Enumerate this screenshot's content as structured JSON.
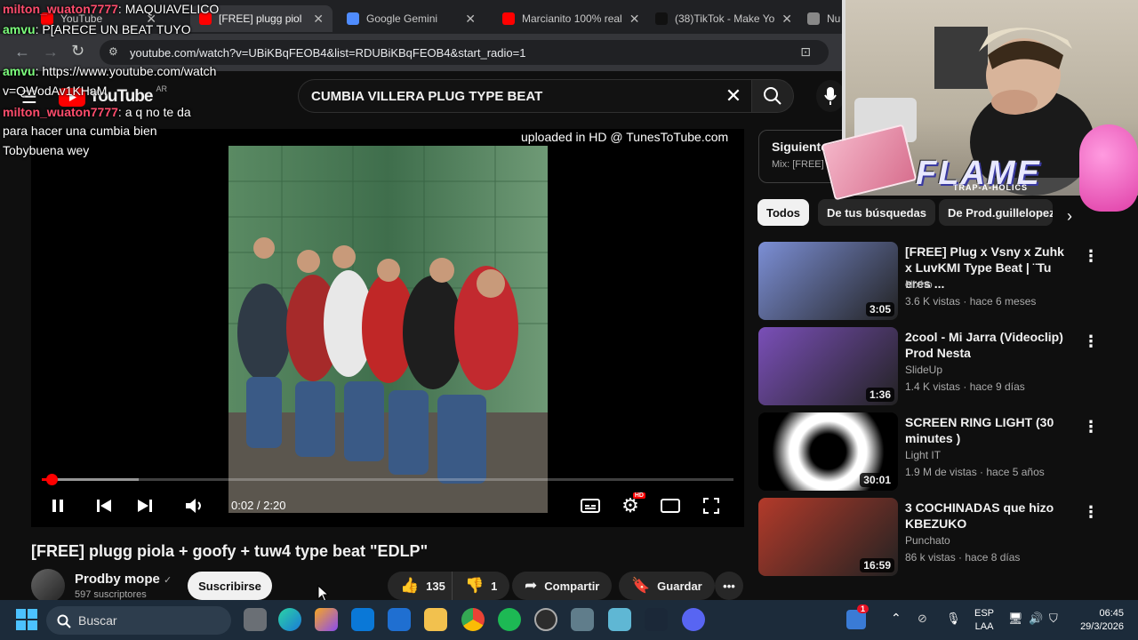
{
  "browser": {
    "tabs": [
      {
        "label": "YouTube",
        "favicon_color": "#ff0000"
      },
      {
        "label": "[FREE] plugg piol",
        "favicon_color": "#ff0000"
      },
      {
        "label": "Google Gemini",
        "favicon_color": "#4f8cff"
      },
      {
        "label": "Marcianito 100% real",
        "favicon_color": "#ff0000"
      },
      {
        "label": "(38)TikTok - Make Yo",
        "favicon_color": "#111111"
      },
      {
        "label": "Nu",
        "favicon_color": "#888888"
      }
    ],
    "url": "youtube.com/watch?v=UBiKBqFEOB4&list=RDUBiKBqFEOB4&start_radio=1"
  },
  "youtube": {
    "logo_text": "YouTube",
    "logo_region": "AR",
    "search_query": "CUMBIA VILLERA PLUG TYPE BEAT"
  },
  "player": {
    "watermark": "uploaded in HD @ TunesToTube.com",
    "time": "0:02 / 2:20",
    "progress_fraction": 0.014,
    "buffer_fraction": 0.14
  },
  "video": {
    "title": "[FREE] plugg piola + goofy + tuw4 type beat \"EDLP\"",
    "channel": "Prodby mope",
    "channel_verified_glyph": "✓",
    "subscribers": "597 suscriptores",
    "subscribe_label": "Suscribirse",
    "likes": "135",
    "dislikes": "1",
    "share_label": "Compartir",
    "save_label": "Guardar"
  },
  "chat": [
    {
      "user": "milton_wuaton7777",
      "msg": ": MAQUIAVELICO",
      "user_color": "#ff4d6d"
    },
    {
      "user": "amvu",
      "msg": ": P[ARECE UN BEAT TUYO",
      "user_color": "#7dff7d"
    },
    {
      "user": "amvu",
      "msg": ": https://www.youtube.com/watch",
      "user_color": "#7dff7d"
    },
    {
      "user": "",
      "msg": "v=QWodAv1KHaM",
      "user_color": "#ffffff"
    },
    {
      "user": "milton_wuaton7777",
      "msg": ": a q no te da",
      "user_color": "#ff4d6d"
    },
    {
      "user": "",
      "msg": "para hacer una cumbia bien",
      "user_color": "#ffffff"
    },
    {
      "user": "",
      "msg": "Tobybuena wey",
      "user_color": "#ffffff"
    }
  ],
  "sidebar": {
    "next_label": "Siguiente:",
    "next_mix": "Mix: [FREE] p",
    "chips": [
      "Todos",
      "De tus búsquedas",
      "De Prod.guillelopez"
    ],
    "recommendations": [
      {
        "title": "[FREE] Plug x Vsny x Zuhk x LuvKMI Type Beat | ¨Tu eres ...",
        "channel": "Nixho",
        "meta": "3.6 K vistas · hace 6 meses",
        "duration": "3:05",
        "thumb_color": "#7c8fd6"
      },
      {
        "title": "2cool - Mi Jarra (Videoclip) Prod Nesta",
        "channel": "SlideUp",
        "meta": "1.4 K vistas · hace 9 días",
        "duration": "1:36",
        "thumb_color": "#7a4fb8"
      },
      {
        "title": "SCREEN RING LIGHT (30 minutes )",
        "channel": "Light IT",
        "meta": "1.9 M de vistas · hace 5 años",
        "duration": "30:01",
        "thumb_color": "#000000"
      },
      {
        "title": "3 COCHINADAS que hizo KBEZUKO",
        "channel": "Punchato",
        "meta": "86 k vistas · hace 8 días",
        "duration": "16:59",
        "thumb_color": "#b33a2a"
      }
    ]
  },
  "overlay": {
    "flame_text": "FLAME",
    "flame_sub": "TRAP-A-HOLICS"
  },
  "taskbar": {
    "search_placeholder": "Buscar",
    "lang_line1": "ESP",
    "lang_line2": "LAA",
    "time": "06:45",
    "date": "29/3/2026",
    "notification_count": "1"
  }
}
